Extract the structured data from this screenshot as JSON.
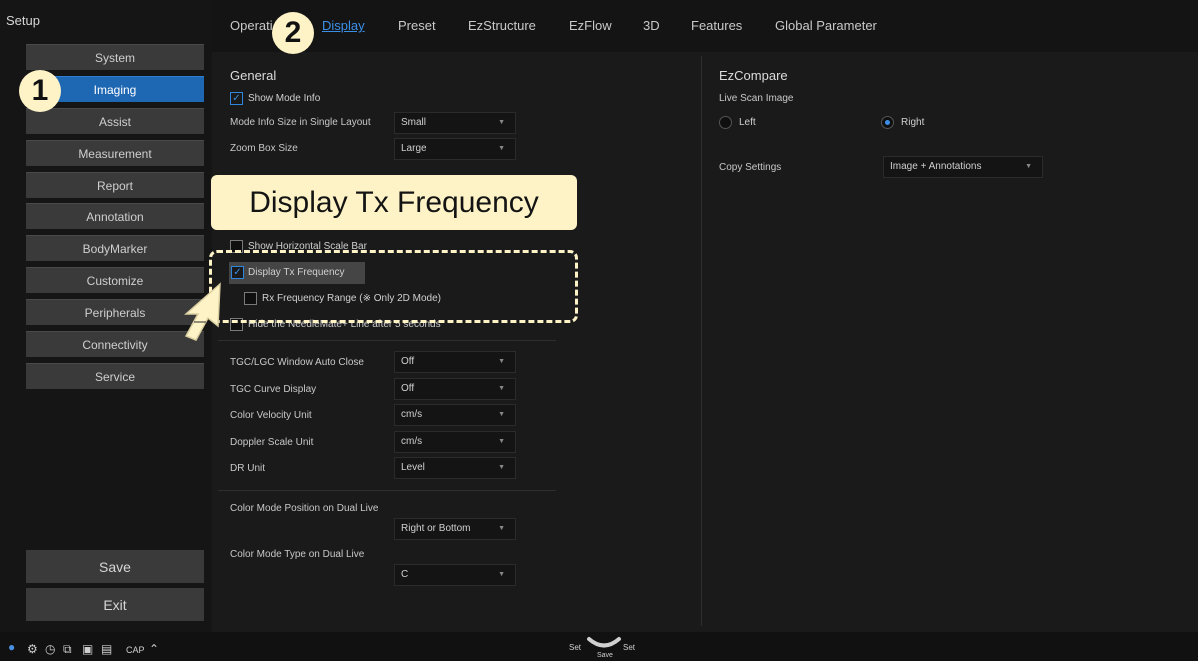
{
  "sidebar": {
    "title": "Setup",
    "items": [
      "System",
      "Imaging",
      "Assist",
      "Measurement",
      "Report",
      "Annotation",
      "BodyMarker",
      "Customize",
      "Peripherals",
      "Connectivity",
      "Service"
    ],
    "save_label": "Save",
    "exit_label": "Exit"
  },
  "tabs": [
    "Operati",
    "Display",
    "Preset",
    "EzStructure",
    "EzFlow",
    "3D",
    "Features",
    "Global Parameter"
  ],
  "general": {
    "heading": "General",
    "show_mode_info": "Show Mode Info",
    "mode_info_size_label": "Mode Info Size in Single Layout",
    "mode_info_size_value": "Small",
    "zoom_box_size_label": "Zoom Box Size",
    "zoom_box_size_value": "Large",
    "show_horizontal_scale_bar": "Show Horizontal Scale Bar",
    "display_tx_frequency": "Display Tx Frequency",
    "rx_frequency_range": "Rx Frequency Range (※ Only 2D Mode)",
    "hide_needlemate": "Hide the NeedleMate+ Line after 5 seconds",
    "tgc_lgc_label": "TGC/LGC Window Auto Close",
    "tgc_lgc_value": "Off",
    "tgc_curve_label": "TGC Curve Display",
    "tgc_curve_value": "Off",
    "color_velocity_label": "Color Velocity Unit",
    "color_velocity_value": "cm/s",
    "doppler_scale_label": "Doppler Scale Unit",
    "doppler_scale_value": "cm/s",
    "dr_unit_label": "DR Unit",
    "dr_unit_value": "Level",
    "color_mode_position_label": "Color Mode Position on Dual Live",
    "color_mode_position_value": "Right or Bottom",
    "color_mode_type_label": "Color Mode Type on Dual Live",
    "color_mode_type_value": "C"
  },
  "ezcompare": {
    "heading": "EzCompare",
    "live_scan_image": "Live Scan Image",
    "left": "Left",
    "right": "Right",
    "copy_settings_label": "Copy Settings",
    "copy_settings_value": "Image + Annotations"
  },
  "overlay": {
    "tooltip": "Display Tx Frequency",
    "step1": "1",
    "step2": "2"
  },
  "statusbar": {
    "cap": "CAP",
    "set_left": "Set",
    "set_right": "Set",
    "save": "Save"
  },
  "colors": {
    "accent": "#1e67b3",
    "highlight": "#fdf3c7",
    "link": "#3b8fe6"
  }
}
